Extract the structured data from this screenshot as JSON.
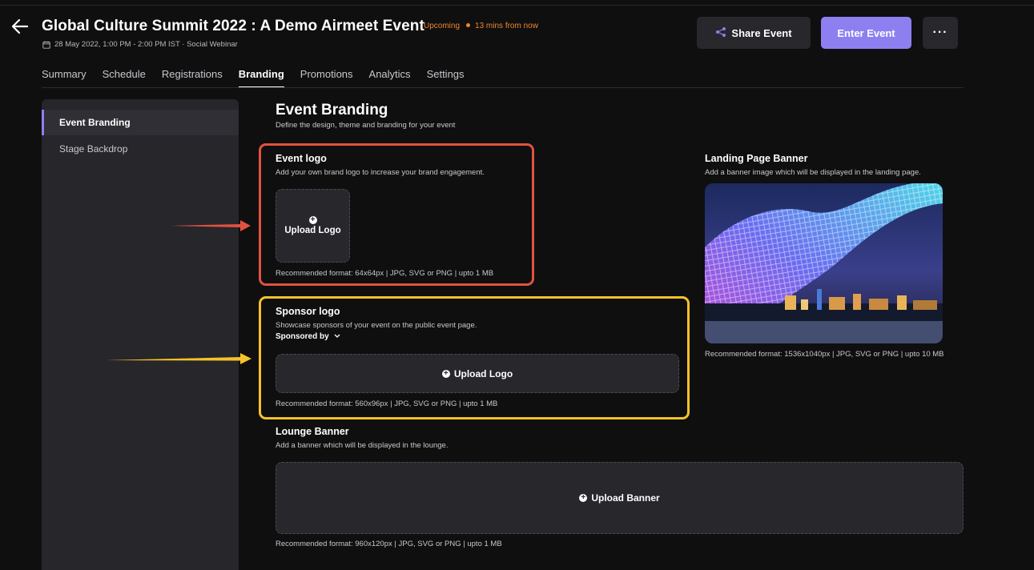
{
  "header": {
    "title": "Global Culture Summit 2022 : A Demo Airmeet Event",
    "status": "Upcoming",
    "status_time": "13 mins from now",
    "date_line": "28 May 2022, 1:00 PM - 2:00 PM IST · Social Webinar",
    "share_label": "Share Event",
    "enter_label": "Enter Event",
    "more_label": "···"
  },
  "tabs": [
    {
      "label": "Summary"
    },
    {
      "label": "Schedule"
    },
    {
      "label": "Registrations"
    },
    {
      "label": "Branding",
      "active": true
    },
    {
      "label": "Promotions"
    },
    {
      "label": "Analytics"
    },
    {
      "label": "Settings"
    }
  ],
  "sidebar": {
    "items": [
      {
        "label": "Event Branding",
        "active": true
      },
      {
        "label": "Stage Backdrop"
      }
    ]
  },
  "main": {
    "title": "Event Branding",
    "subtitle": "Define the design, theme and branding for your event",
    "event_logo": {
      "title": "Event logo",
      "desc": "Add your own brand logo to increase your brand engagement.",
      "upload_label": "Upload Logo",
      "format": "Recommended format: 64x64px | JPG, SVG or PNG | upto 1 MB"
    },
    "sponsor_logo": {
      "title": "Sponsor logo",
      "desc": "Showcase sponsors of your event on the public event page.",
      "dropdown_value": "Sponsored by",
      "upload_label": "Upload Logo",
      "format": "Recommended format: 560x96px | JPG, SVG or PNG | upto 1 MB"
    },
    "landing_banner": {
      "title": "Landing Page Banner",
      "desc": "Add a banner image which will be displayed in the landing page.",
      "format": "Recommended format: 1536x1040px | JPG, SVG or PNG | upto 10 MB"
    },
    "lounge_banner": {
      "title": "Lounge Banner",
      "desc": "Add a banner which will be displayed in the lounge.",
      "upload_label": "Upload Banner",
      "format": "Recommended format: 960x120px | JPG, SVG or PNG | upto 1 MB"
    }
  },
  "colors": {
    "accent": "#8e7ff0",
    "status": "#f0862b",
    "highlight_red": "#e2523f",
    "highlight_yellow": "#f5c228",
    "background": "#0f0f10",
    "panel": "#26262b"
  },
  "icons": [
    "back-arrow-icon",
    "calendar-icon",
    "share-icon",
    "more-icon",
    "plus-circle-icon",
    "chevron-down-icon"
  ]
}
